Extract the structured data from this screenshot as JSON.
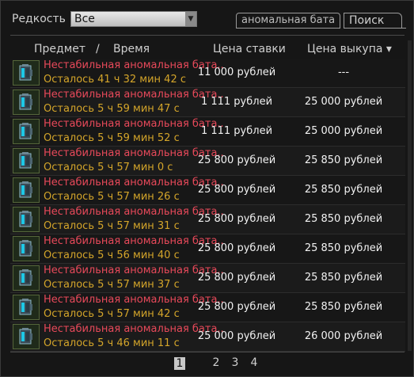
{
  "filters": {
    "rarity_label": "Редкость",
    "rarity_value": "Все",
    "search_value": "аномальная бата",
    "search_button": "Поиск"
  },
  "table": {
    "headers": {
      "item": "Предмет",
      "separator": "/",
      "time": "Время",
      "bid": "Цена ставки",
      "buyout": "Цена выкупа ▾"
    },
    "rows": [
      {
        "name": "Нестабильная аномальная бата..",
        "time": "Осталось 41 ч 32 мин 42 с",
        "bid": "11 000 рублей",
        "buyout": "---"
      },
      {
        "name": "Нестабильная аномальная бата..",
        "time": "Осталось 5 ч 59 мин 47 с",
        "bid": "1 111 рублей",
        "buyout": "25 000 рублей"
      },
      {
        "name": "Нестабильная аномальная бата..",
        "time": "Осталось 5 ч 59 мин 52 с",
        "bid": "1 111 рублей",
        "buyout": "25 000 рублей"
      },
      {
        "name": "Нестабильная аномальная бата..",
        "time": "Осталось 5 ч 57 мин 0 с",
        "bid": "25 800 рублей",
        "buyout": "25 850 рублей"
      },
      {
        "name": "Нестабильная аномальная бата..",
        "time": "Осталось 5 ч 57 мин 26 с",
        "bid": "25 800 рублей",
        "buyout": "25 850 рублей"
      },
      {
        "name": "Нестабильная аномальная бата..",
        "time": "Осталось 5 ч 57 мин 31 с",
        "bid": "25 800 рублей",
        "buyout": "25 850 рублей"
      },
      {
        "name": "Нестабильная аномальная бата..",
        "time": "Осталось 5 ч 56 мин 40 с",
        "bid": "25 800 рублей",
        "buyout": "25 850 рублей"
      },
      {
        "name": "Нестабильная аномальная бата..",
        "time": "Осталось 5 ч 57 мин 37 с",
        "bid": "25 800 рублей",
        "buyout": "25 850 рублей"
      },
      {
        "name": "Нестабильная аномальная бата..",
        "time": "Осталось 5 ч 57 мин 42 с",
        "bid": "25 800 рублей",
        "buyout": "25 850 рублей"
      },
      {
        "name": "Нестабильная аномальная бата..",
        "time": "Осталось 5 ч 46 мин 11 с",
        "bid": "25 000 рублей",
        "buyout": "26 000 рублей"
      }
    ]
  },
  "pagination": {
    "pages": [
      "1",
      "2",
      "3",
      "4"
    ],
    "current": "1"
  },
  "colors": {
    "item_name": "#e8495a",
    "time_left": "#d4a52a",
    "price": "#f2f2f2"
  },
  "icons": {
    "item_thumbnail": "battery-icon",
    "dropdown": "chevron-down-icon"
  }
}
